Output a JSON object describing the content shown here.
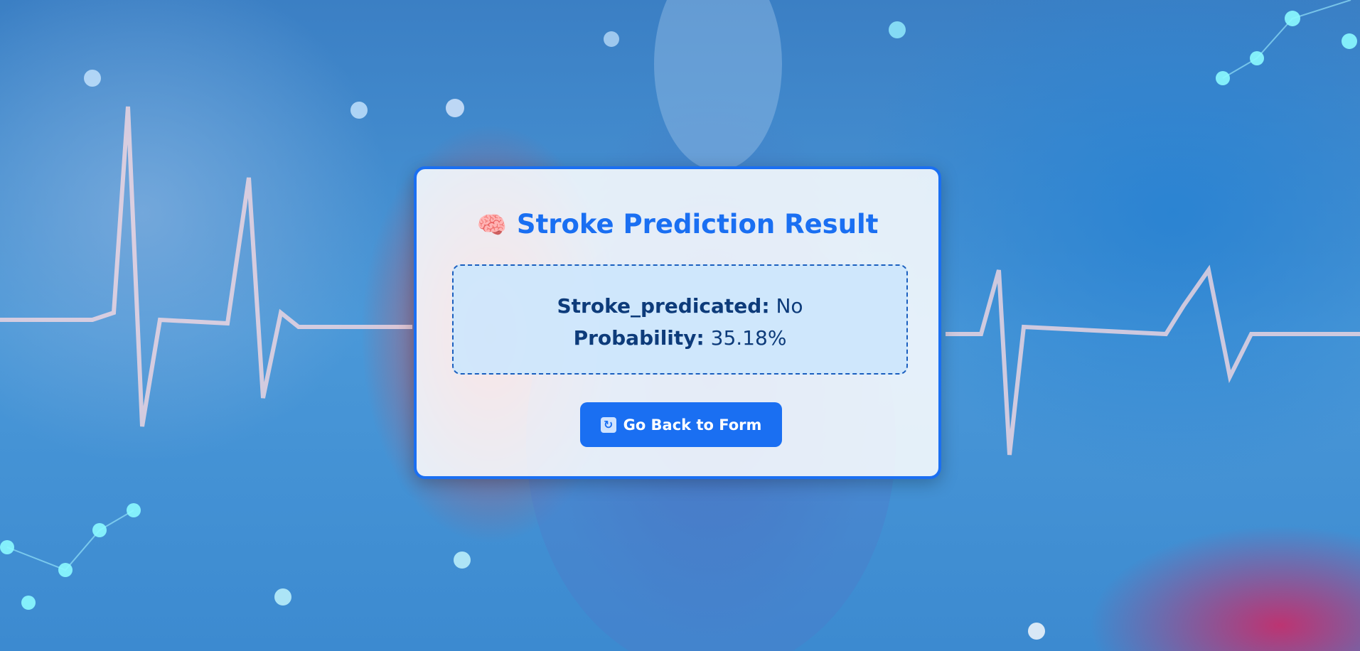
{
  "colors": {
    "accent": "#1a6ff2",
    "result_text": "#0d3b7a",
    "result_bg": "#cde6fc"
  },
  "card": {
    "title_icon": "brain-icon",
    "title": "Stroke Prediction Result"
  },
  "result": {
    "stroke_label": "Stroke_predicated:",
    "stroke_value": "No",
    "probability_label": "Probability:",
    "probability_value": "35.18%"
  },
  "actions": {
    "back_icon": "repeat-icon",
    "back_label": "Go Back to Form"
  }
}
